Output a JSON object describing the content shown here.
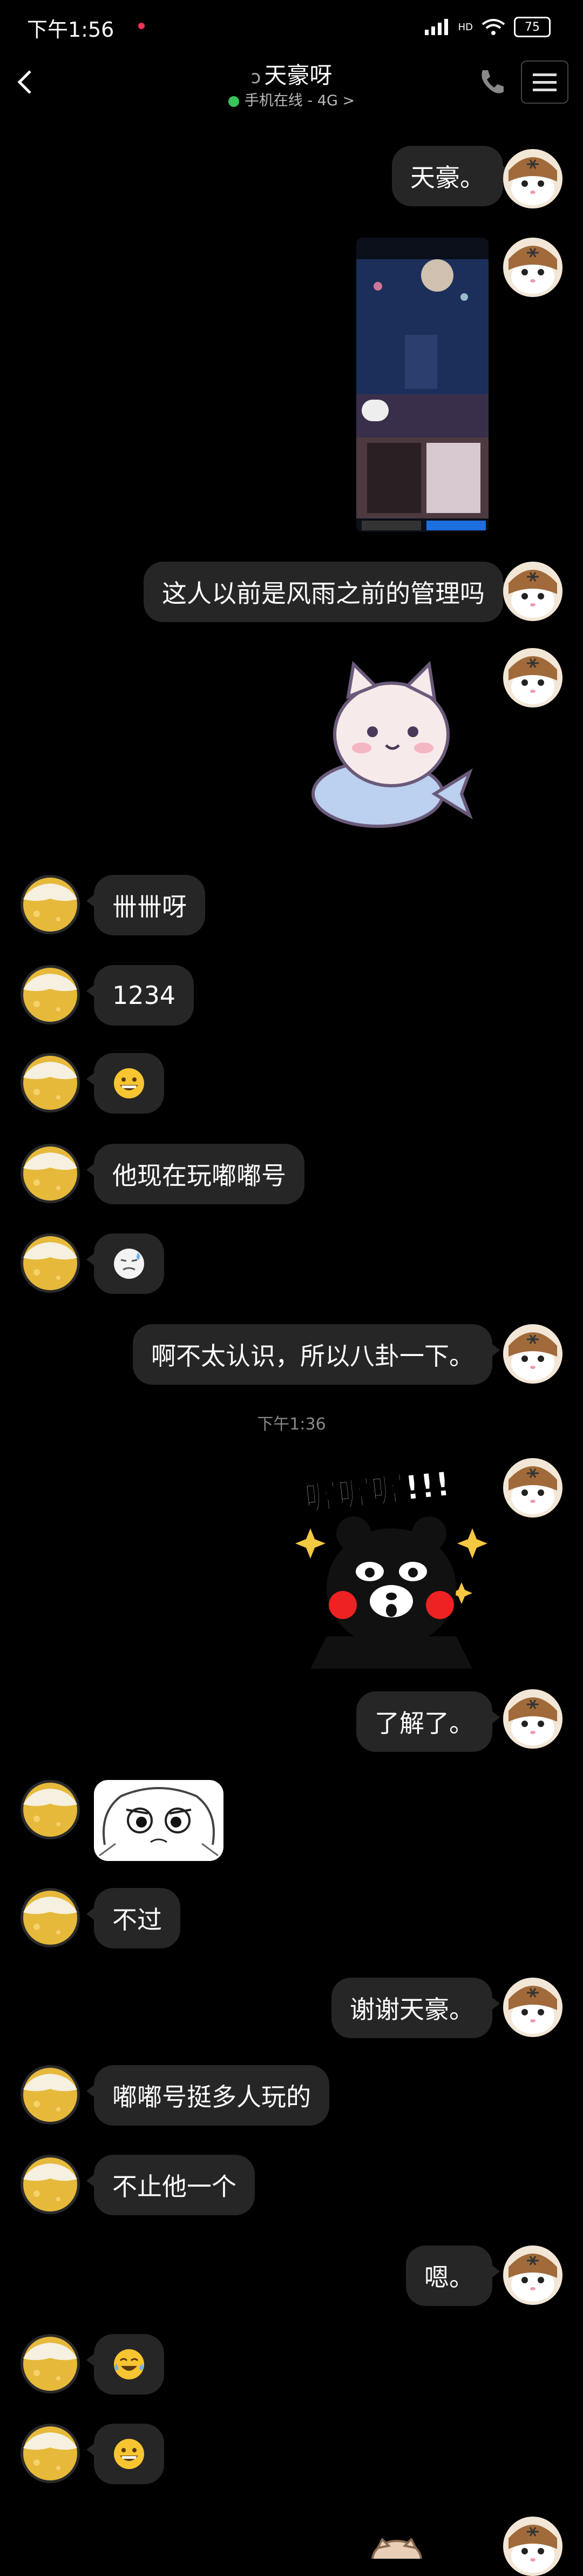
{
  "status_bar": {
    "time": "下午1:56",
    "network": "HD",
    "battery": "75"
  },
  "header": {
    "title": "天豪呀",
    "subtitle": "手机在线 - 4G",
    "subtitle_arrow": ">",
    "back_icon": "chevron-left-icon",
    "phone_icon": "phone-icon",
    "menu_icon": "hamburger-icon"
  },
  "messages": [
    {
      "side": "right",
      "type": "text",
      "text": "天豪。"
    },
    {
      "side": "right",
      "type": "image"
    },
    {
      "side": "right",
      "type": "text",
      "text": "这人以前是风雨之前的管理吗"
    },
    {
      "side": "right",
      "type": "sticker",
      "sticker": "cat-on-fish"
    },
    {
      "side": "left",
      "type": "text",
      "text": "卌卌呀"
    },
    {
      "side": "left",
      "type": "text",
      "text": "1234"
    },
    {
      "side": "left",
      "type": "emoji",
      "emoji": "grin-emoji"
    },
    {
      "side": "left",
      "type": "text",
      "text": "他现在玩嘟嘟号"
    },
    {
      "side": "left",
      "type": "emoji",
      "emoji": "sweat-emoji"
    },
    {
      "side": "right",
      "type": "text",
      "text": "啊不太认识，所以八卦一下。"
    },
    {
      "side": "center",
      "type": "time",
      "text": "下午1:36"
    },
    {
      "side": "right",
      "type": "sticker",
      "sticker": "kumamon",
      "caption": "喔喔喔!!!"
    },
    {
      "side": "right",
      "type": "text",
      "text": "了解了。"
    },
    {
      "side": "left",
      "type": "sticker",
      "sticker": "cartoon-face"
    },
    {
      "side": "left",
      "type": "text",
      "text": "不过"
    },
    {
      "side": "right",
      "type": "text",
      "text": "谢谢天豪。"
    },
    {
      "side": "left",
      "type": "text",
      "text": "嘟嘟号挺多人玩的"
    },
    {
      "side": "left",
      "type": "text",
      "text": "不止他一个"
    },
    {
      "side": "right",
      "type": "text",
      "text": "嗯。"
    },
    {
      "side": "left",
      "type": "emoji",
      "emoji": "tears-of-joy-emoji"
    },
    {
      "side": "left",
      "type": "emoji",
      "emoji": "grin-emoji"
    }
  ],
  "colors": {
    "bubble": "#262626",
    "online": "#39c45a",
    "background": "#000000"
  }
}
